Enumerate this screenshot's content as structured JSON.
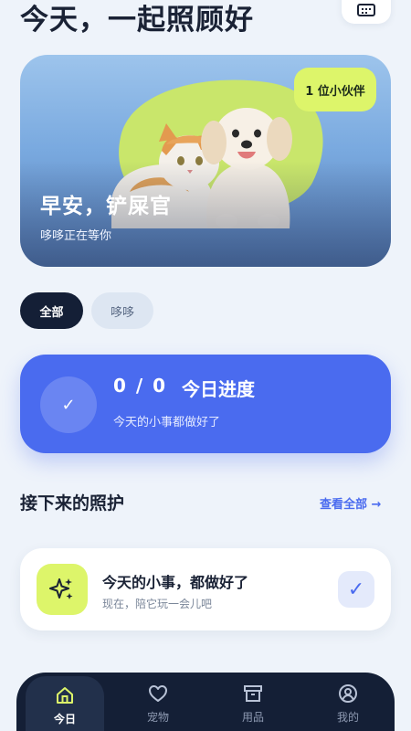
{
  "header": {
    "title": "今天，一起照顾好",
    "calendar_icon": "calendar-icon"
  },
  "hero": {
    "badge": "1 位小伙伴",
    "greeting": "早安，铲屎官",
    "subtitle": "哆哆正在等你",
    "colors": {
      "blob": "#C9E66B",
      "badge": "#DDF56A"
    }
  },
  "filters": {
    "items": [
      {
        "label": "全部",
        "selected": true
      },
      {
        "label": "哆哆",
        "selected": false
      }
    ]
  },
  "progress": {
    "count": "0 / 0",
    "label": "今日进度",
    "hint": "今天的小事都做好了",
    "check_glyph": "✓",
    "accent": "#4A6BEF"
  },
  "upcoming": {
    "title": "接下来的照护",
    "view_all": "查看全部 →"
  },
  "task": {
    "title": "今天的小事，都做好了",
    "subtitle": "现在，陪它玩一会儿吧",
    "icon": "sparkle-icon",
    "check_glyph": "✓"
  },
  "nav": {
    "items": [
      {
        "label": "今日",
        "icon": "home-icon",
        "active": true
      },
      {
        "label": "宠物",
        "icon": "heart-icon",
        "active": false
      },
      {
        "label": "用品",
        "icon": "box-icon",
        "active": false
      },
      {
        "label": "我的",
        "icon": "user-icon",
        "active": false
      }
    ]
  }
}
